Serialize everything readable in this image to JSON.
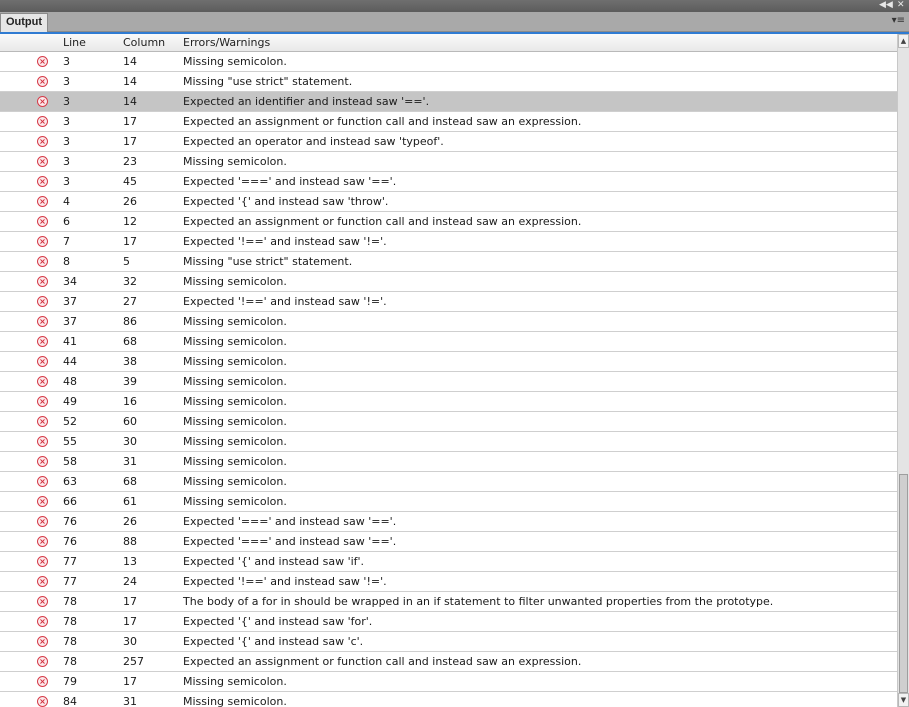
{
  "window": {
    "panel_tab": "Output",
    "collapse_icon": "double-chevron-left-icon",
    "close_icon": "close-icon",
    "menu_icon": "panel-menu-icon"
  },
  "columns": {
    "line": "Line",
    "column": "Column",
    "message": "Errors/Warnings"
  },
  "colors": {
    "accent": "#2f7bd2",
    "error": "#d22b39",
    "selected_row": "#c5c5c5"
  },
  "scrollbar": {
    "thumb_start_fraction": 0.66,
    "thumb_end_fraction": 1.0
  },
  "selected_index": 2,
  "rows": [
    {
      "type": "error",
      "line": "3",
      "column": "14",
      "message": "Missing semicolon."
    },
    {
      "type": "error",
      "line": "3",
      "column": "14",
      "message": "Missing \"use strict\" statement."
    },
    {
      "type": "error",
      "line": "3",
      "column": "14",
      "message": "Expected an identifier and instead saw '=='."
    },
    {
      "type": "error",
      "line": "3",
      "column": "17",
      "message": "Expected an assignment or function call and instead saw an expression."
    },
    {
      "type": "error",
      "line": "3",
      "column": "17",
      "message": "Expected an operator and instead saw 'typeof'."
    },
    {
      "type": "error",
      "line": "3",
      "column": "23",
      "message": "Missing semicolon."
    },
    {
      "type": "error",
      "line": "3",
      "column": "45",
      "message": "Expected '===' and instead saw '=='."
    },
    {
      "type": "error",
      "line": "4",
      "column": "26",
      "message": "Expected '{' and instead saw 'throw'."
    },
    {
      "type": "error",
      "line": "6",
      "column": "12",
      "message": "Expected an assignment or function call and instead saw an expression."
    },
    {
      "type": "error",
      "line": "7",
      "column": "17",
      "message": "Expected '!==' and instead saw '!='."
    },
    {
      "type": "error",
      "line": "8",
      "column": "5",
      "message": "Missing \"use strict\" statement."
    },
    {
      "type": "error",
      "line": "34",
      "column": "32",
      "message": "Missing semicolon."
    },
    {
      "type": "error",
      "line": "37",
      "column": "27",
      "message": "Expected '!==' and instead saw '!='."
    },
    {
      "type": "error",
      "line": "37",
      "column": "86",
      "message": "Missing semicolon."
    },
    {
      "type": "error",
      "line": "41",
      "column": "68",
      "message": "Missing semicolon."
    },
    {
      "type": "error",
      "line": "44",
      "column": "38",
      "message": "Missing semicolon."
    },
    {
      "type": "error",
      "line": "48",
      "column": "39",
      "message": "Missing semicolon."
    },
    {
      "type": "error",
      "line": "49",
      "column": "16",
      "message": "Missing semicolon."
    },
    {
      "type": "error",
      "line": "52",
      "column": "60",
      "message": "Missing semicolon."
    },
    {
      "type": "error",
      "line": "55",
      "column": "30",
      "message": "Missing semicolon."
    },
    {
      "type": "error",
      "line": "58",
      "column": "31",
      "message": "Missing semicolon."
    },
    {
      "type": "error",
      "line": "63",
      "column": "68",
      "message": "Missing semicolon."
    },
    {
      "type": "error",
      "line": "66",
      "column": "61",
      "message": "Missing semicolon."
    },
    {
      "type": "error",
      "line": "76",
      "column": "26",
      "message": "Expected '===' and instead saw '=='."
    },
    {
      "type": "error",
      "line": "76",
      "column": "88",
      "message": "Expected '===' and instead saw '=='."
    },
    {
      "type": "error",
      "line": "77",
      "column": "13",
      "message": "Expected '{' and instead saw 'if'."
    },
    {
      "type": "error",
      "line": "77",
      "column": "24",
      "message": "Expected '!==' and instead saw '!='."
    },
    {
      "type": "error",
      "line": "78",
      "column": "17",
      "message": "The body of a for in should be wrapped in an if statement to filter unwanted properties from the prototype."
    },
    {
      "type": "error",
      "line": "78",
      "column": "17",
      "message": "Expected '{' and instead saw 'for'."
    },
    {
      "type": "error",
      "line": "78",
      "column": "30",
      "message": "Expected '{' and instead saw 'c'."
    },
    {
      "type": "error",
      "line": "78",
      "column": "257",
      "message": "Expected an assignment or function call and instead saw an expression."
    },
    {
      "type": "error",
      "line": "79",
      "column": "17",
      "message": "Missing semicolon."
    },
    {
      "type": "error",
      "line": "84",
      "column": "31",
      "message": "Missing semicolon."
    }
  ]
}
